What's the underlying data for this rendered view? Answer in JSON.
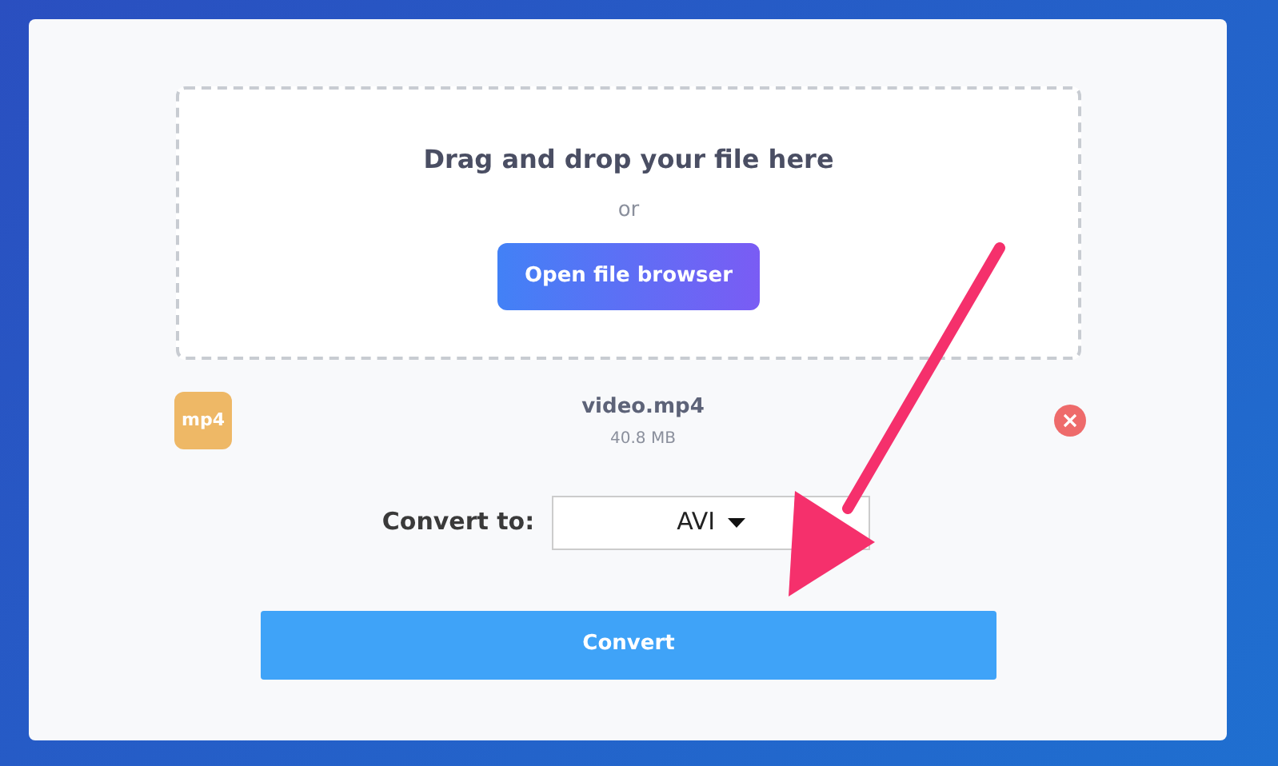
{
  "dropzone": {
    "title": "Drag and drop your file here",
    "separator": "or",
    "button": "Open file browser"
  },
  "file": {
    "type_label": "mp4",
    "name": "video.mp4",
    "size": "40.8 MB"
  },
  "convert": {
    "label": "Convert to:",
    "value": "AVI"
  },
  "convert_button": "Convert"
}
